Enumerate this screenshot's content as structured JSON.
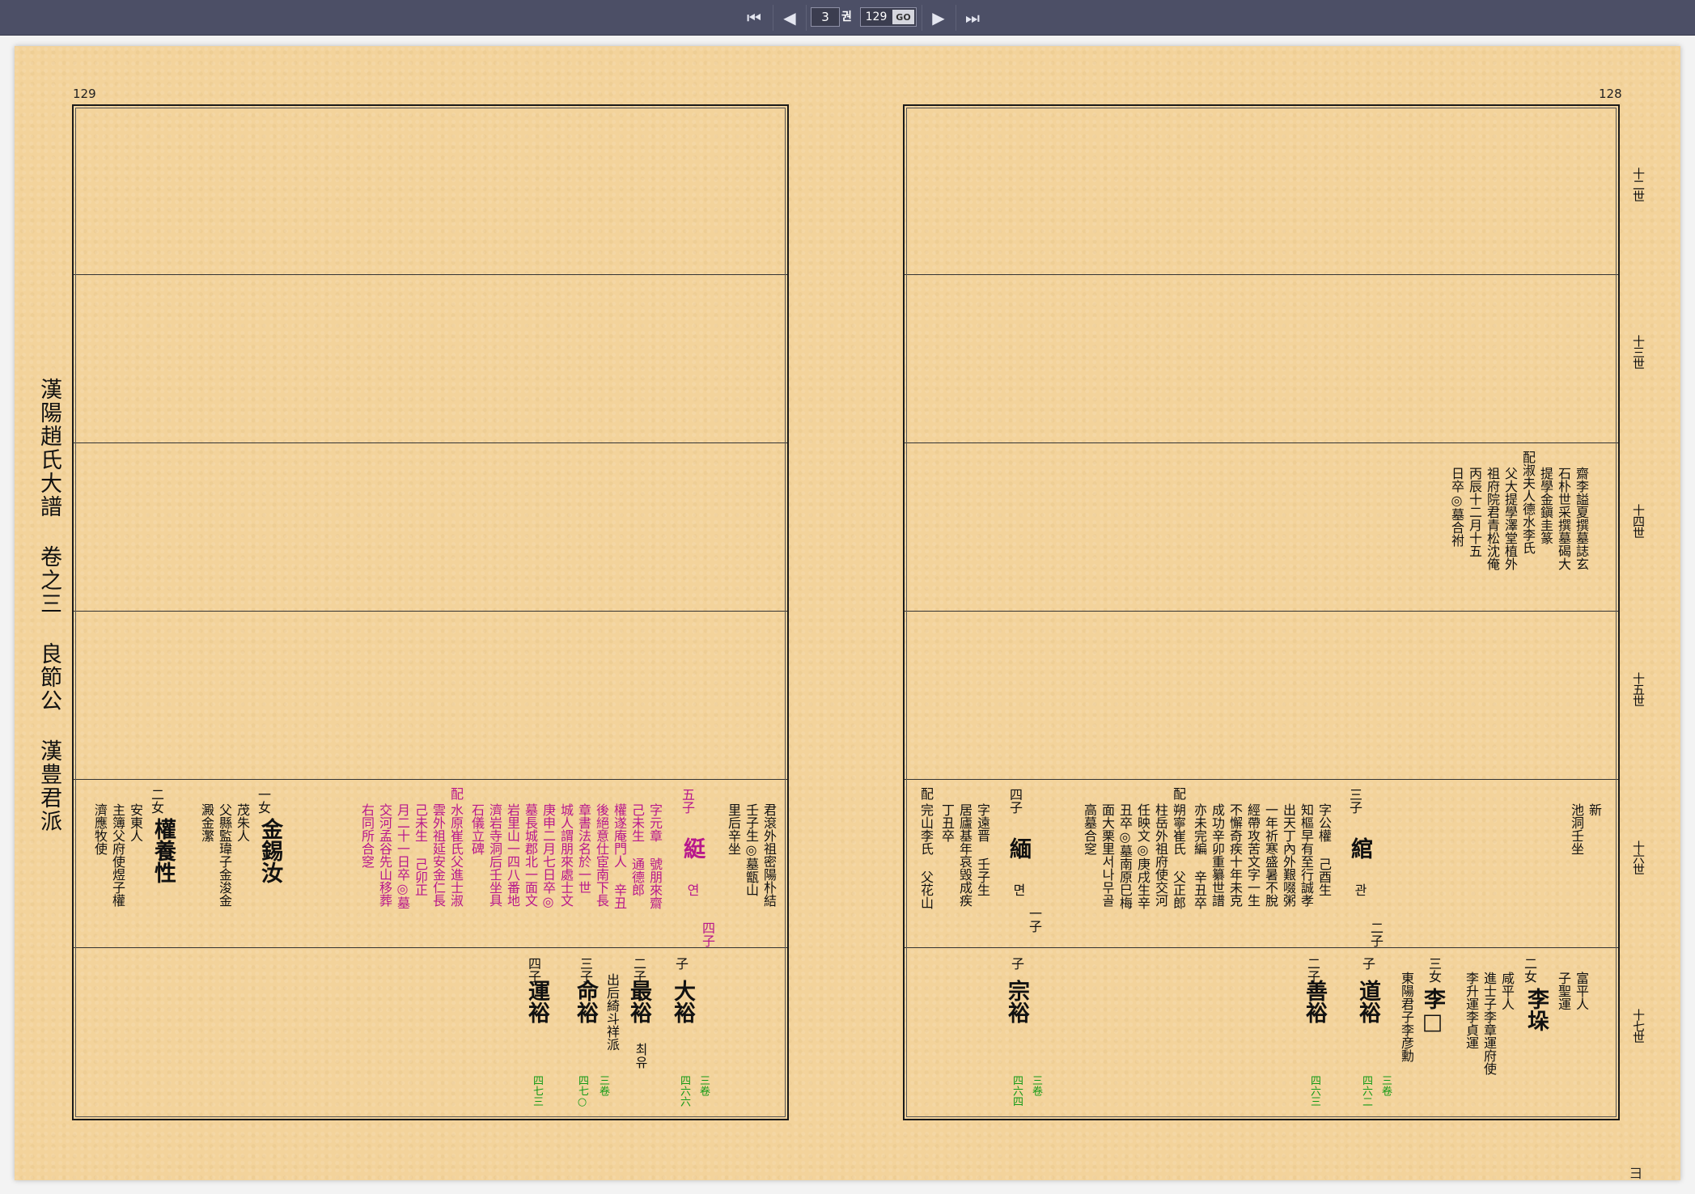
{
  "toolbar": {
    "first_icon": "⏮",
    "prev_icon": "◀",
    "page_value": "3",
    "page_unit": "권",
    "goto_value": "129",
    "go_label": "GO",
    "next_icon": "▶",
    "last_icon": "⏭"
  },
  "book": {
    "title": "漢陽趙氏大譜 卷之三 良節公 漢豊君派",
    "left_page_number": "129",
    "right_page_number": "128",
    "corner_mark": "彐"
  },
  "generations": [
    "十二世",
    "十三世",
    "十四世",
    "十五世",
    "十六世",
    "十七世"
  ],
  "right_page": {
    "gen14_note": [
      "齋李謚夏撰墓誌玄",
      "石朴世采撰墓碣大",
      "提學金鎭圭篆",
      "配淑夫人德水李氏",
      "父大提學澤堂植外",
      "祖府院君青松沈俺",
      "丙辰十二月十五",
      "日卒◎墓合祔"
    ],
    "gen16_note": [
      "新",
      "池洞壬坐"
    ],
    "c3_head": "三子",
    "c3_name": "綰",
    "c3_hangul": "관",
    "c3_order": "二子",
    "c3_bio": [
      "字公權 己酉生",
      "知樞早有至行誠孝",
      "出天丁內外艱啜粥",
      "一年祈寒盛暑不脫",
      "經帶攻苦文字一生",
      "不懈奇疾十年未克",
      "成功辛卯重纂世譜",
      "亦未完編 辛丑卒"
    ],
    "c3_spouse": [
      "配",
      "朔寧崔氏 父正郎",
      "柱岳外祖府使交河",
      "任映文◎庚戌生辛",
      "丑卒◎墓南原巳梅",
      "面大栗里서나무골",
      "高墓合窆"
    ],
    "c4_head": "四子",
    "c4_name": "緬",
    "c4_hangul": "면",
    "c4_order": "一子",
    "c4_bio": [
      "字遠晋 壬子生",
      "居廬基年哀毁成疾",
      "丁丑卒"
    ],
    "c4_spouse": [
      "配",
      "完山李氏 父花山"
    ],
    "g17_a_name": "宗裕",
    "g17_a_head": "子",
    "g17_a_ref": [
      "三卷",
      "四六四"
    ],
    "g17_b_head": "二子",
    "g17_b_name": "善裕",
    "g17_b_ref": "四六三",
    "g17_c_head": "子",
    "g17_c_name": "道裕",
    "g17_c_ref": [
      "三卷",
      "四六二"
    ],
    "g17_d_head": "三女",
    "g17_d_name": "李□",
    "g17_d_note": "東陽君子李彦勳",
    "g17_e_head": "二女",
    "g17_e_name": "李垛",
    "g17_e_note": [
      "進士子李章運府使",
      "咸平人",
      "李升運李貞運"
    ],
    "g17_f_note": [
      "富平人",
      "子聖運"
    ]
  },
  "left_page": {
    "g16_a_note": [
      "君滾外祖密陽朴結",
      "壬子生◎墓甑山",
      "里后辛坐"
    ],
    "g16_b_head": "五子",
    "g16_b_name": "綎",
    "g16_b_hangul": "연",
    "g16_b_order": "四子",
    "g16_b_bio": [
      "字元章 號朋來齋",
      "己未生 通德郎",
      "權遂庵門人 辛丑",
      "後絕意仕宦南下長",
      "章書法名於一世",
      "城人謂朋來處士文",
      "庚申二月七日卒◎",
      "墓長城郡北一面文",
      "岩里山一四八番地",
      "濟岩寺洞后壬坐具",
      "石儀立碑"
    ],
    "g16_b_spouse": [
      "配",
      "水原崔氏父進士淑",
      "雲外祖延安金仁長",
      "己未生 己卯正",
      "月二十一日卒◎墓",
      "交河孟谷先山移葬",
      "右同所合窆"
    ],
    "g16_c_head": "一女",
    "g16_c_name": "金錫汝",
    "g16_c_note": [
      "茂朱人",
      "父縣監瑋子金浚金",
      "澱金瀿"
    ],
    "g16_d_head": "二女",
    "g16_d_name": "權養性",
    "g16_d_note": [
      "安東人",
      "主簿父府使煜子權",
      "濟應牧使"
    ],
    "g17_a_head": "子",
    "g17_a_name": "大裕",
    "g17_a_ref": [
      "三卷",
      "四六六"
    ],
    "g17_b_head": "二子",
    "g17_b_name": "最裕",
    "g17_b_hangul": "최유",
    "g17_b_note": "出后綺斗祥派",
    "g17_c_head": "三子",
    "g17_c_name": "命裕",
    "g17_c_ref": [
      "三卷",
      "四七○"
    ],
    "g17_d_head": "四子",
    "g17_d_name": "運裕",
    "g17_d_ref": "四七三"
  }
}
